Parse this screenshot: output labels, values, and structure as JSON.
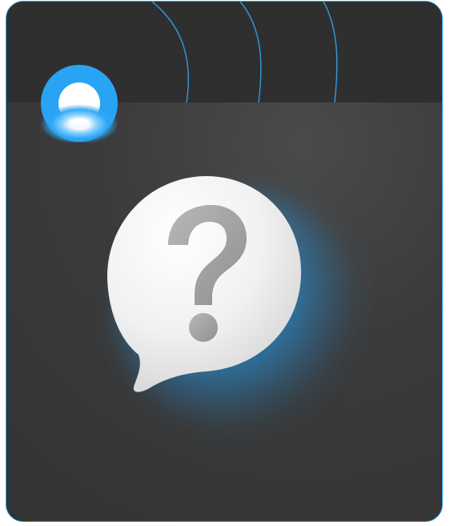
{
  "graphic": {
    "icon": "question-bubble-icon",
    "colors": {
      "border": "#2fa6f2",
      "top_band": "#2f2f2f",
      "panel": "#383838",
      "glow": "#23a0f5",
      "bubble": "#f1f1f1",
      "question_mark": "#a8a8a8"
    }
  }
}
